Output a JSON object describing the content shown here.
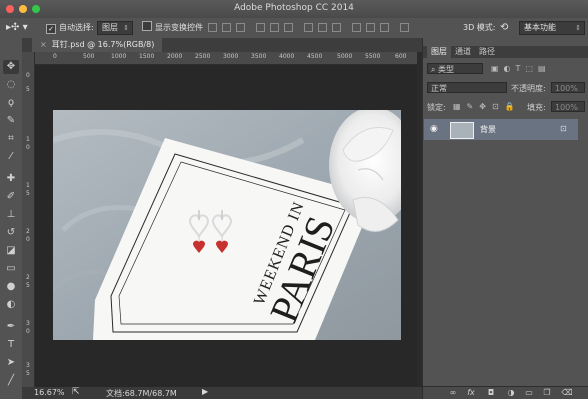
{
  "window": {
    "title": "Adobe Photoshop CC 2014",
    "buttons": [
      "#fc605c",
      "#fdbc40",
      "#34c84a"
    ]
  },
  "options": {
    "auto_select_label": "自动选择:",
    "auto_select_value": "图层",
    "show_transform_label": "显示变换控件",
    "mode_3d_label": "3D 模式:",
    "workspace": "基本功能"
  },
  "document": {
    "tab_label": "耳钉.psd @ 16.7%(RGB/8)",
    "close_glyph": "×",
    "ruler_h": [
      "0",
      "500",
      "1000",
      "1500",
      "2000",
      "2500",
      "3000",
      "3500",
      "4000",
      "4500",
      "5000",
      "5500",
      "600"
    ],
    "ruler_v": [
      "0",
      "5",
      "1",
      "0",
      "1",
      "5",
      "2",
      "0",
      "2",
      "5",
      "3",
      "0",
      "3",
      "5"
    ],
    "zoom": "16.67%",
    "doc_info": "文档:68.7M/68.7M"
  },
  "photo": {
    "line1": "WEEKEND IN",
    "line2": "PARIS"
  },
  "panel": {
    "tabs": [
      "图层",
      "通道",
      "路径"
    ],
    "filter_label": "类型",
    "blend_mode": "正常",
    "opacity_label": "不透明度:",
    "opacity_value": "100%",
    "lock_label": "锁定:",
    "fill_label": "填充:",
    "fill_value": "100%",
    "layer_name": "背景",
    "bottom_icons": [
      "link-icon",
      "fx-icon",
      "mask-icon",
      "adjustment-icon",
      "folder-icon",
      "new-layer-icon",
      "trash-icon"
    ]
  }
}
